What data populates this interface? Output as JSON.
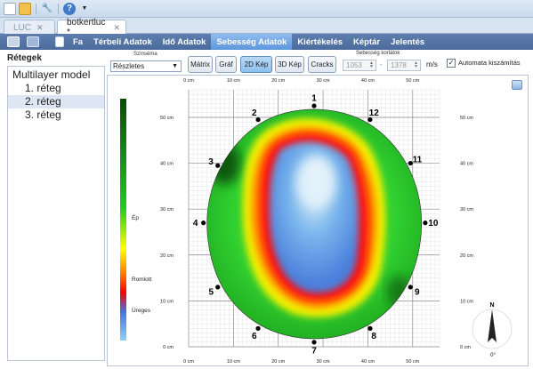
{
  "tabs": [
    {
      "label": "LUC",
      "close": "✕"
    },
    {
      "label": "botkertluc *",
      "close": "✕"
    }
  ],
  "menu": {
    "items": [
      "Fa",
      "Térbeli Adatok",
      "Idő Adatok",
      "Sebesség Adatok",
      "Kiértékelés",
      "Képtár",
      "Jelentés"
    ],
    "active_index": 3
  },
  "left_panel": {
    "title": "Rétegek",
    "root": "Multilayer model",
    "items": [
      "1. réteg",
      "2. réteg",
      "3. réteg"
    ],
    "selected_index": 1
  },
  "controls": {
    "color_scheme_label": "Színséma",
    "color_scheme_value": "Részletes",
    "view_buttons": [
      "Mátrix",
      "Gráf",
      "2D Kép",
      "3D Kép",
      "Cracks"
    ],
    "active_view_index": 2,
    "speed_limits_label": "Sebesség korlátok",
    "speed_min": "1053",
    "speed_dash": "-",
    "speed_max": "1378",
    "speed_unit": "m/s",
    "auto_calc_label": "Automata kiszámítás",
    "auto_calc_checked": true
  },
  "chart": {
    "x_ticks": [
      "0 cm",
      "10 cm",
      "20 cm",
      "30 cm",
      "40 cm",
      "50 cm"
    ],
    "y_ticks": [
      "50 cm",
      "40 cm",
      "30 cm",
      "20 cm",
      "10 cm",
      "0 cm"
    ],
    "legend": {
      "good": "Ép",
      "damaged": "Romlott",
      "hollow": "Üreges"
    },
    "sensors": [
      {
        "label": "1",
        "x": 28.0,
        "y": 52.5
      },
      {
        "label": "2",
        "x": 15.5,
        "y": 49.5
      },
      {
        "label": "3",
        "x": 6.5,
        "y": 39.5
      },
      {
        "label": "4",
        "x": 3.3,
        "y": 27.0
      },
      {
        "label": "5",
        "x": 6.5,
        "y": 13.0
      },
      {
        "label": "6",
        "x": 15.5,
        "y": 4.0
      },
      {
        "label": "7",
        "x": 28.0,
        "y": 1.0
      },
      {
        "label": "8",
        "x": 40.5,
        "y": 4.0
      },
      {
        "label": "9",
        "x": 49.5,
        "y": 13.0
      },
      {
        "label": "10",
        "x": 52.8,
        "y": 27.0
      },
      {
        "label": "11",
        "x": 49.5,
        "y": 40.0
      },
      {
        "label": "12",
        "x": 40.5,
        "y": 49.5
      }
    ],
    "compass": {
      "north": "N",
      "angle": "0°"
    }
  },
  "colors": {
    "ribbon_bg": "#4a6b9c",
    "active_menu": "#6da4e4",
    "good": "#1a7a1a",
    "damaged": "#ff0000",
    "hollow": "#7ab8f0"
  }
}
